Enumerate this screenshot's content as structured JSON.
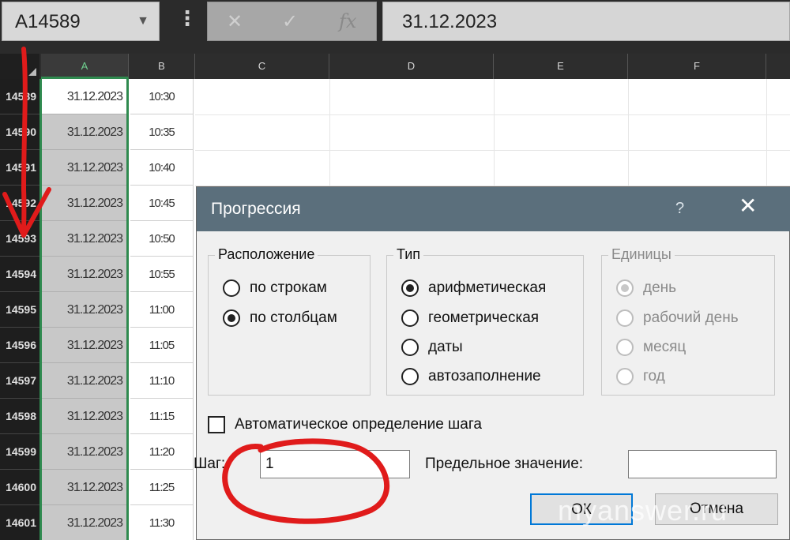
{
  "formula_bar": {
    "name_box": "A14589",
    "cancel_icon": "✕",
    "enter_icon": "✓",
    "fx_label": "fx",
    "value": "31.12.2023"
  },
  "columns": [
    {
      "label": "A",
      "selected": true
    },
    {
      "label": "B"
    },
    {
      "label": "C"
    },
    {
      "label": "D"
    },
    {
      "label": "E"
    },
    {
      "label": "F"
    }
  ],
  "rows": [
    {
      "num": "14589",
      "a": "31.12.2023",
      "b": "10:30"
    },
    {
      "num": "14590",
      "a": "31.12.2023",
      "b": "10:35"
    },
    {
      "num": "14591",
      "a": "31.12.2023",
      "b": "10:40"
    },
    {
      "num": "14592",
      "a": "31.12.2023",
      "b": "10:45"
    },
    {
      "num": "14593",
      "a": "31.12.2023",
      "b": "10:50"
    },
    {
      "num": "14594",
      "a": "31.12.2023",
      "b": "10:55"
    },
    {
      "num": "14595",
      "a": "31.12.2023",
      "b": "11:00"
    },
    {
      "num": "14596",
      "a": "31.12.2023",
      "b": "11:05"
    },
    {
      "num": "14597",
      "a": "31.12.2023",
      "b": "11:10"
    },
    {
      "num": "14598",
      "a": "31.12.2023",
      "b": "11:15"
    },
    {
      "num": "14599",
      "a": "31.12.2023",
      "b": "11:20"
    },
    {
      "num": "14600",
      "a": "31.12.2023",
      "b": "11:25"
    },
    {
      "num": "14601",
      "a": "31.12.2023",
      "b": "11:30"
    }
  ],
  "dialog": {
    "title": "Прогрессия",
    "help": "?",
    "close": "✕",
    "location_group": {
      "title": "Расположение",
      "options": [
        {
          "label": "по строкам",
          "checked": false
        },
        {
          "label": "по столбцам",
          "checked": true
        }
      ]
    },
    "type_group": {
      "title": "Тип",
      "options": [
        {
          "label": "арифметическая",
          "checked": true
        },
        {
          "label": "геометрическая",
          "checked": false
        },
        {
          "label": "даты",
          "checked": false
        },
        {
          "label": "автозаполнение",
          "checked": false
        }
      ]
    },
    "units_group": {
      "title": "Единицы",
      "disabled": true,
      "options": [
        {
          "label": "день",
          "checked": true
        },
        {
          "label": "рабочий день",
          "checked": false
        },
        {
          "label": "месяц",
          "checked": false
        },
        {
          "label": "год",
          "checked": false
        }
      ]
    },
    "auto_step": {
      "label": "Автоматическое определение шага",
      "checked": false
    },
    "step": {
      "label": "Шаг:",
      "value": "1"
    },
    "limit": {
      "label": "Предельное значение:",
      "value": ""
    },
    "ok": "ОК",
    "cancel": "Отмена"
  },
  "annotation_colors": {
    "arrow": "#e01b1b",
    "circle": "#e01b1b"
  },
  "watermark": "myanswer.ru"
}
